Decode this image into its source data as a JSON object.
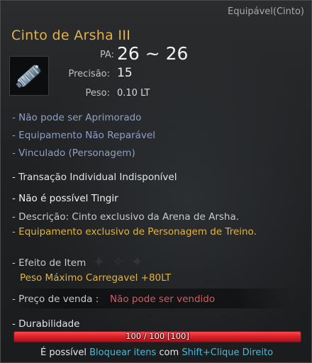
{
  "item": {
    "slot": "Equipável(Cinto)",
    "name": "Cinto de Arsha III",
    "icon": "belt-icon"
  },
  "stats": {
    "pa_label": "PA:",
    "pa_value": "26 ~ 26",
    "precision_label": "Precisão:",
    "precision_value": "15",
    "weight_label": "Peso:",
    "weight_value": "0.10 LT"
  },
  "restrictions": [
    "- Não pode ser Aprimorado",
    "- Equipamento Não Reparável",
    "- Vinculado (Personagem)"
  ],
  "trade": "- Transação Individual Indisponível",
  "dye": "- Não é possível Tingir",
  "description": {
    "line1": "- Descrição: Cinto exclusivo da Arena de Arsha.",
    "line2": "- Equipamento exclusivo de Personagem de Treino."
  },
  "effect": {
    "header": "- Efeito de Item",
    "value": "Peso Máximo Carregavel +80LT"
  },
  "price": {
    "label": "- Preço de venda :",
    "value": "Não pode ser vendido"
  },
  "durability": {
    "label": "- Durabilidade",
    "text": "100 / 100  [100]",
    "fraction": 1.0
  },
  "footer": {
    "part1": "É possível",
    "link1": "Bloquear itens",
    "part2": "com",
    "link2": "Shift+Clique Direito"
  },
  "colors": {
    "title": "#e4b14a",
    "gold": "#e6b437",
    "blue": "#8fa0c4",
    "red": "#d65a62",
    "bar": "#e0222a",
    "cyan": "#4fb8d4"
  }
}
